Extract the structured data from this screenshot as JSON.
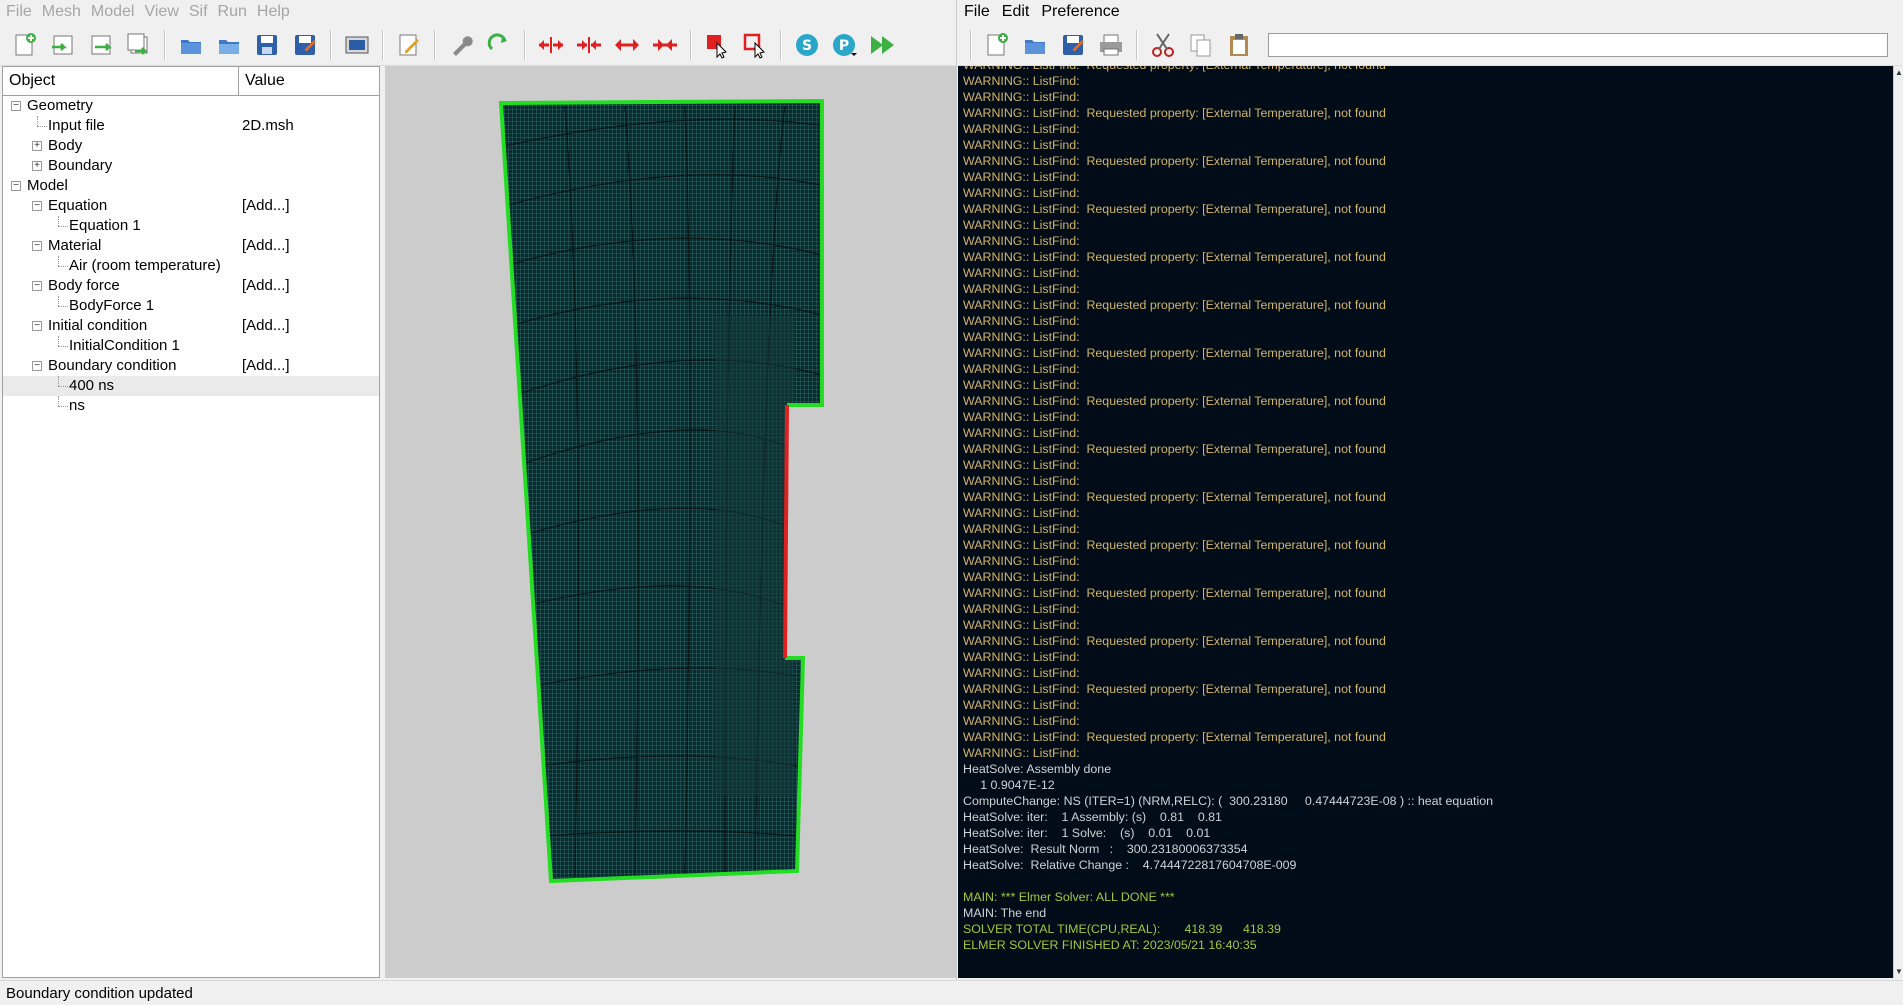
{
  "left_window": {
    "menu": [
      "File",
      "Mesh",
      "Model",
      "View",
      "Sif",
      "Run",
      "Help"
    ],
    "status": "Boundary condition updated"
  },
  "tree": {
    "col_object": "Object",
    "col_value": "Value",
    "rows": [
      {
        "label": "Geometry",
        "value": "",
        "level": 0,
        "exp": "minus"
      },
      {
        "label": "Input file",
        "value": "2D.msh",
        "level": 1,
        "exp": "none"
      },
      {
        "label": "Body",
        "value": "",
        "level": 1,
        "exp": "plus"
      },
      {
        "label": "Boundary",
        "value": "",
        "level": 1,
        "exp": "plus"
      },
      {
        "label": "Model",
        "value": "",
        "level": 0,
        "exp": "minus"
      },
      {
        "label": "Equation",
        "value": "[Add...]",
        "level": 1,
        "exp": "minus"
      },
      {
        "label": "Equation 1",
        "value": "",
        "level": 2,
        "exp": "none"
      },
      {
        "label": "Material",
        "value": "[Add...]",
        "level": 1,
        "exp": "minus"
      },
      {
        "label": "Air (room temperature)",
        "value": "",
        "level": 2,
        "exp": "none"
      },
      {
        "label": "Body force",
        "value": "[Add...]",
        "level": 1,
        "exp": "minus"
      },
      {
        "label": "BodyForce 1",
        "value": "",
        "level": 2,
        "exp": "none"
      },
      {
        "label": "Initial condition",
        "value": "[Add...]",
        "level": 1,
        "exp": "minus"
      },
      {
        "label": "InitialCondition 1",
        "value": "",
        "level": 2,
        "exp": "none"
      },
      {
        "label": "Boundary condition",
        "value": "[Add...]",
        "level": 1,
        "exp": "minus"
      },
      {
        "label": "400 ns",
        "value": "",
        "level": 2,
        "exp": "none",
        "selected": true
      },
      {
        "label": "ns",
        "value": "",
        "level": 2,
        "exp": "none"
      }
    ]
  },
  "right_window": {
    "menu": [
      "File",
      "Edit",
      "Preference"
    ],
    "search_value": ""
  },
  "log": {
    "warn_find": "WARNING:: ListFind:",
    "warn_prop": "WARNING:: ListFind:  Requested property: [External Temperature], not found",
    "pattern_repeats": 14,
    "tail_lines": [
      {
        "text": "HeatSolve: Assembly done",
        "cls": "n"
      },
      {
        "text": "     1 0.9047E-12",
        "cls": "n"
      },
      {
        "text": "ComputeChange: NS (ITER=1) (NRM,RELC): (  300.23180     0.47444723E-08 ) :: heat equation",
        "cls": "n"
      },
      {
        "text": "HeatSolve: iter:    1 Assembly: (s)    0.81    0.81",
        "cls": "n"
      },
      {
        "text": "HeatSolve: iter:    1 Solve:    (s)    0.01    0.01",
        "cls": "n"
      },
      {
        "text": "HeatSolve:  Result Norm   :    300.23180006373354",
        "cls": "n"
      },
      {
        "text": "HeatSolve:  Relative Change :    4.7444722817604708E-009",
        "cls": "n"
      },
      {
        "text": "",
        "cls": "n"
      },
      {
        "text": "MAIN: *** Elmer Solver: ALL DONE ***",
        "cls": "g"
      },
      {
        "text": "MAIN: The end",
        "cls": "n"
      },
      {
        "text": "SOLVER TOTAL TIME(CPU,REAL):       418.39      418.39",
        "cls": "g"
      },
      {
        "text": "ELMER SOLVER FINISHED AT: 2023/05/21 16:40:35",
        "cls": "g"
      }
    ]
  },
  "colors": {
    "mesh_fill": "#0b2a2e",
    "boundary_green": "#22dd22",
    "boundary_red": "#e02020",
    "log_bg": "#000c17",
    "log_warn": "#d4b467",
    "log_ok": "#a5c53a"
  }
}
